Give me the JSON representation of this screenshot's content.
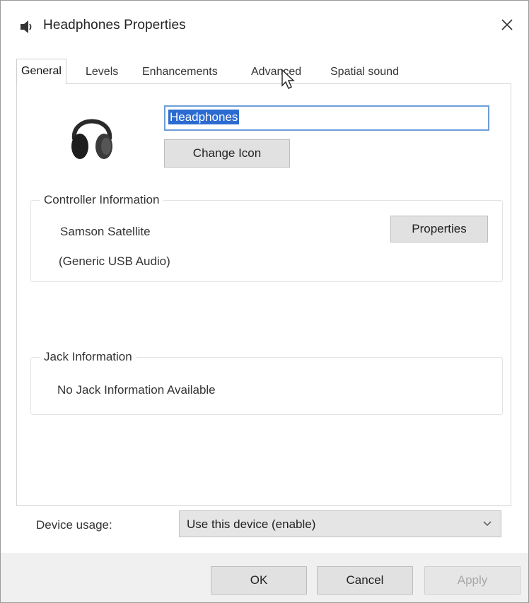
{
  "window": {
    "title": "Headphones Properties",
    "title_icon": "speaker-icon",
    "close_icon": "close-icon"
  },
  "tabs": [
    {
      "label": "General",
      "active": true
    },
    {
      "label": "Levels",
      "active": false
    },
    {
      "label": "Enhancements",
      "active": false
    },
    {
      "label": "Advanced",
      "active": false
    },
    {
      "label": "Spatial sound",
      "active": false
    }
  ],
  "general": {
    "device_icon": "headphones-icon",
    "device_name": "Headphones",
    "change_icon_label": "Change Icon",
    "controller": {
      "legend": "Controller Information",
      "name": "Samson Satellite",
      "driver": "(Generic USB Audio)",
      "properties_label": "Properties"
    },
    "jack": {
      "legend": "Jack Information",
      "text": "No Jack Information Available"
    },
    "device_usage": {
      "label": "Device usage:",
      "value": "Use this device (enable)",
      "chevron_icon": "chevron-down-icon"
    }
  },
  "footer": {
    "ok_label": "OK",
    "cancel_label": "Cancel",
    "apply_label": "Apply"
  },
  "colors": {
    "selection": "#2b6bd1",
    "input_focus_border": "#6d9ed8",
    "button_face": "#e1e1e1",
    "disabled_text": "#a8a8a8"
  }
}
